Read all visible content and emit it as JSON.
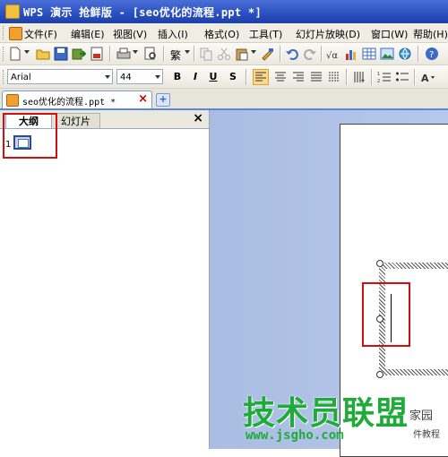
{
  "window": {
    "title": "WPS 演示 抢鲜版 - [seo优化的流程.ppt *]"
  },
  "menu": [
    "文件(F)",
    "编辑(E)",
    "视图(V)",
    "插入(I)",
    "格式(O)",
    "工具(T)",
    "幻灯片放映(D)",
    "窗口(W)",
    "帮助(H)"
  ],
  "toolbar": {
    "traditional_label": "繁"
  },
  "format_bar": {
    "font_name": "Arial",
    "font_size": "44",
    "bold": "B",
    "italic": "I",
    "underline": "U",
    "shadow": "S"
  },
  "document_tab": {
    "label": "seo优化的流程.ppt *",
    "close": "×",
    "new_tab": "+"
  },
  "left_panel": {
    "tabs": [
      "大纲",
      "幻灯片"
    ],
    "active_tab": "大纲",
    "close": "×",
    "slide_number": "1"
  },
  "watermark": {
    "main": "技术员联盟",
    "url": "www.jsgho.com",
    "home": "家园",
    "tutorial": "件教程"
  },
  "colors": {
    "title_bar": "#2a4fbf",
    "canvas": "#b0c4e8",
    "highlight": "#d01010",
    "watermark": "#1faa3a"
  }
}
